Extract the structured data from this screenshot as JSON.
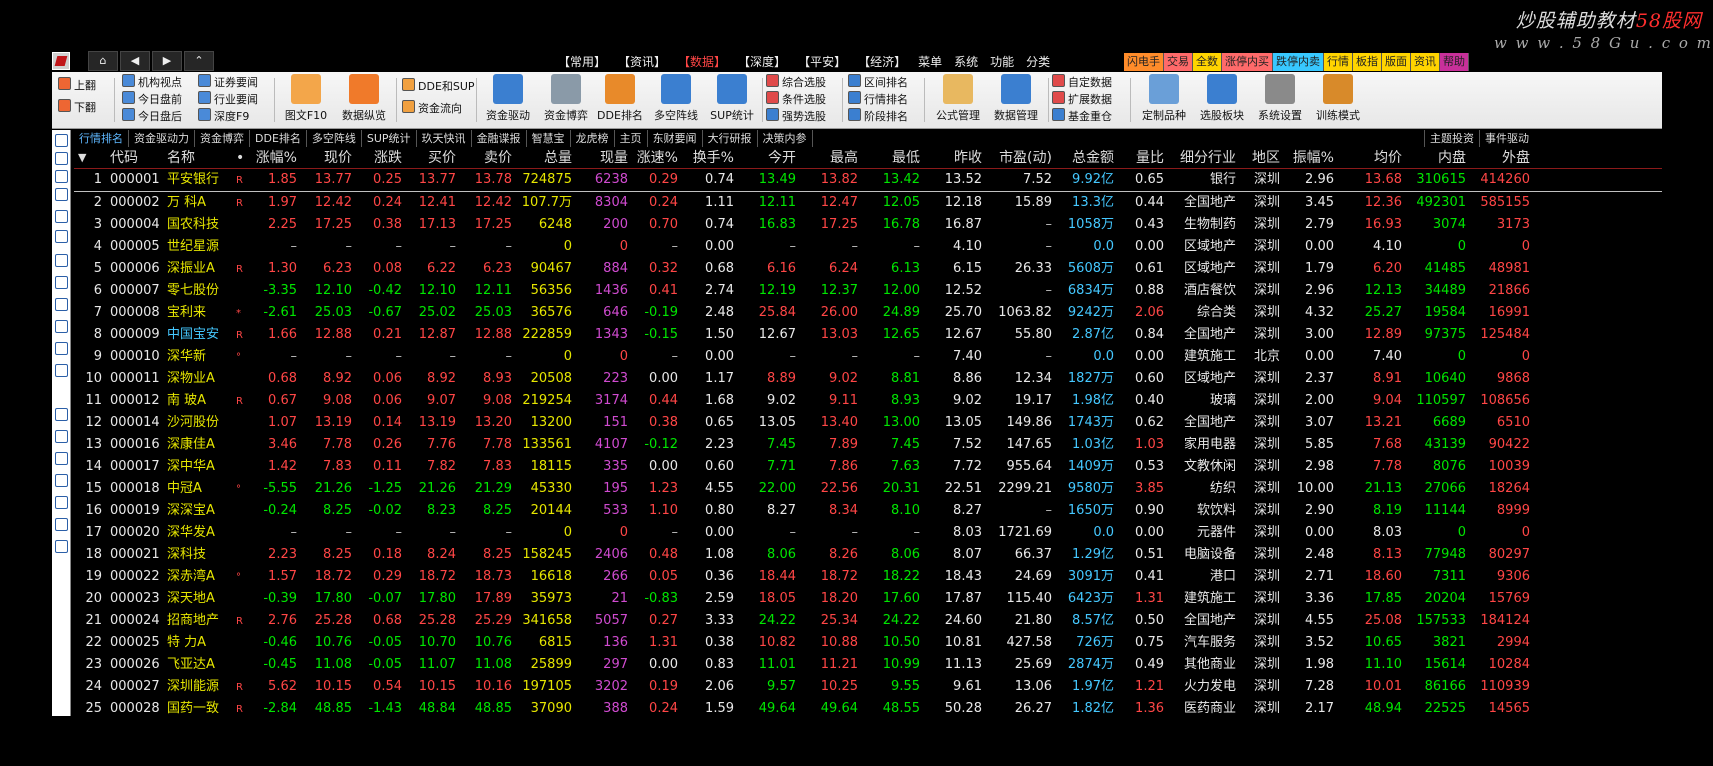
{
  "watermark": {
    "line1_a": "炒股辅助教材",
    "line1_b": "58股网",
    "line2": "w w w . 5 8 G u . c o m"
  },
  "nav": {
    "home": "⌂",
    "back": "◀",
    "forward": "▶",
    "up": "⌃"
  },
  "menu": {
    "items": [
      "【常用】",
      "【资讯】",
      "【数据】",
      "【深度】",
      "【平安】",
      "【经济】",
      "菜单",
      "系统",
      "功能",
      "分类"
    ],
    "active_index": 2,
    "right_tabs": [
      {
        "label": "闪电手",
        "bg": "#ff8c2a"
      },
      {
        "label": "交易",
        "bg": "#ff6a6a"
      },
      {
        "label": "全数",
        "bg": "#ffd400"
      },
      {
        "label": "涨停内买",
        "bg": "#ff6a6a"
      },
      {
        "label": "跌停内卖",
        "bg": "#38c8ff"
      },
      {
        "label": "行情",
        "bg": "#ffd400"
      },
      {
        "label": "板指",
        "bg": "#ffd400"
      },
      {
        "label": "版面",
        "bg": "#ffd400"
      },
      {
        "label": "资讯",
        "bg": "#ffd400"
      },
      {
        "label": "帮助",
        "bg": "#c8309a"
      }
    ]
  },
  "toolbar": {
    "flip_up": "上翻",
    "flip_down": "下翻",
    "inst_view": "机构视点",
    "today_before": "今日盘前",
    "today_after": "今日盘后",
    "broker_report": "证券要闻",
    "industry_news": "行业要闻",
    "depth_f9": "深度F9",
    "f10": "图文F10",
    "data_view": "数据纵览",
    "dde_sup": "DDE和SUP",
    "fund_flow": "资金流向",
    "fund_drive": "资金驱动",
    "fund_game": "资金博弈",
    "dde_rank": "DDE排名",
    "multi_line": "多空阵线",
    "sup_stat": "SUP统计",
    "combo_pick": "综合选股",
    "cond_pick": "条件选股",
    "strong_pick": "强势选股",
    "range_rank": "区间排名",
    "quote_rank": "行情排名",
    "stage_rank": "阶段排名",
    "formula_mgr": "公式管理",
    "data_mgr": "数据管理",
    "custom_data": "自定数据",
    "ext_data": "扩展数据",
    "fund_pos": "基金重仓",
    "custom_kind": "定制品种",
    "pick_board": "选股板块",
    "sys_set": "系统设置",
    "train_mode": "训练模式"
  },
  "func_tabs": [
    "行情排名",
    "资金驱动力",
    "资金博弈",
    "DDE排名",
    "多空阵线",
    "SUP统计",
    "玖天快讯",
    "金融谍报",
    "智慧宝",
    "龙虎榜",
    "主页",
    "东财要闻",
    "大行研报",
    "决策内参"
  ],
  "func_tabs_active": 0,
  "func_tabs_right": [
    "主题投资",
    "事件驱动"
  ],
  "table": {
    "sort_icon": "▼",
    "columns": [
      "代码",
      "名称",
      "•",
      "涨幅%",
      "现价",
      "涨跌",
      "买价",
      "卖价",
      "总量",
      "现量",
      "涨速%",
      "换手%",
      "今开",
      "最高",
      "最低",
      "昨收",
      "市盈(动)",
      "总金额",
      "量比",
      "细分行业",
      "地区",
      "振幅%",
      "均价",
      "内盘",
      "外盘"
    ],
    "rows": [
      {
        "n": "1",
        "code": "000001",
        "name": "平安银行",
        "mk": "R",
        "pct": "1.85",
        "price": "13.77",
        "chg": "0.25",
        "bid": "13.77",
        "ask": "13.78",
        "vol": "724875",
        "cur": "6238",
        "spd": "0.29",
        "turn": "0.74",
        "open": "13.49",
        "high": "13.82",
        "low": "13.42",
        "prev": "13.52",
        "pe": "7.52",
        "amt": "9.92亿",
        "lb": "0.65",
        "ind": "银行",
        "reg": "深圳",
        "amp": "2.96",
        "avg": "13.68",
        "inn": "310615",
        "out": "414260",
        "t": "u"
      },
      {
        "n": "2",
        "code": "000002",
        "name": "万  科A",
        "mk": "R",
        "pct": "1.97",
        "price": "12.42",
        "chg": "0.24",
        "bid": "12.41",
        "ask": "12.42",
        "vol": "107.7万",
        "cur": "8304",
        "spd": "0.24",
        "turn": "1.11",
        "open": "12.11",
        "high": "12.47",
        "low": "12.05",
        "prev": "12.18",
        "pe": "15.89",
        "amt": "13.3亿",
        "lb": "0.44",
        "ind": "全国地产",
        "reg": "深圳",
        "amp": "3.45",
        "avg": "12.36",
        "inn": "492301",
        "out": "585155",
        "t": "u"
      },
      {
        "n": "3",
        "code": "000004",
        "name": "国农科技",
        "mk": "",
        "pct": "2.25",
        "price": "17.25",
        "chg": "0.38",
        "bid": "17.13",
        "ask": "17.25",
        "vol": "6248",
        "cur": "200",
        "spd": "0.70",
        "turn": "0.74",
        "open": "16.83",
        "high": "17.25",
        "low": "16.78",
        "prev": "16.87",
        "pe": "–",
        "amt": "1058万",
        "lb": "0.43",
        "ind": "生物制药",
        "reg": "深圳",
        "amp": "2.79",
        "avg": "16.93",
        "inn": "3074",
        "out": "3173",
        "t": "u"
      },
      {
        "n": "4",
        "code": "000005",
        "name": "世纪星源",
        "mk": "",
        "pct": "–",
        "price": "–",
        "chg": "–",
        "bid": "–",
        "ask": "–",
        "vol": "0",
        "cur": "0",
        "spd": "–",
        "turn": "0.00",
        "open": "–",
        "high": "–",
        "low": "–",
        "prev": "4.10",
        "pe": "–",
        "amt": "0.0",
        "lb": "0.00",
        "ind": "区域地产",
        "reg": "深圳",
        "amp": "0.00",
        "avg": "4.10",
        "inn": "0",
        "out": "0",
        "t": "n"
      },
      {
        "n": "5",
        "code": "000006",
        "name": "深振业A",
        "mk": "R",
        "pct": "1.30",
        "price": "6.23",
        "chg": "0.08",
        "bid": "6.22",
        "ask": "6.23",
        "vol": "90467",
        "cur": "884",
        "spd": "0.32",
        "turn": "0.68",
        "open": "6.16",
        "high": "6.24",
        "low": "6.13",
        "prev": "6.15",
        "pe": "26.33",
        "amt": "5608万",
        "lb": "0.61",
        "ind": "区域地产",
        "reg": "深圳",
        "amp": "1.79",
        "avg": "6.20",
        "inn": "41485",
        "out": "48981",
        "t": "u"
      },
      {
        "n": "6",
        "code": "000007",
        "name": "零七股份",
        "mk": "",
        "pct": "-3.35",
        "price": "12.10",
        "chg": "-0.42",
        "bid": "12.10",
        "ask": "12.11",
        "vol": "56356",
        "cur": "1436",
        "spd": "0.41",
        "turn": "2.74",
        "open": "12.19",
        "high": "12.37",
        "low": "12.00",
        "prev": "12.52",
        "pe": "–",
        "amt": "6834万",
        "lb": "0.88",
        "ind": "酒店餐饮",
        "reg": "深圳",
        "amp": "2.96",
        "avg": "12.13",
        "inn": "34489",
        "out": "21866",
        "t": "d"
      },
      {
        "n": "7",
        "code": "000008",
        "name": "宝利来",
        "mk": "*",
        "pct": "-2.61",
        "price": "25.03",
        "chg": "-0.67",
        "bid": "25.02",
        "ask": "25.03",
        "vol": "36576",
        "cur": "646",
        "spd": "-0.19",
        "turn": "2.48",
        "open": "25.84",
        "high": "26.00",
        "low": "24.89",
        "prev": "25.70",
        "pe": "1063.82",
        "amt": "9242万",
        "lb": "2.06",
        "ind": "综合类",
        "reg": "深圳",
        "amp": "4.32",
        "avg": "25.27",
        "inn": "19584",
        "out": "16991",
        "t": "d"
      },
      {
        "n": "8",
        "code": "000009",
        "name": "中国宝安",
        "mk": "R",
        "pct": "1.66",
        "price": "12.88",
        "chg": "0.21",
        "bid": "12.87",
        "ask": "12.88",
        "vol": "222859",
        "cur": "1343",
        "spd": "-0.15",
        "turn": "1.50",
        "open": "12.67",
        "high": "13.03",
        "low": "12.65",
        "prev": "12.67",
        "pe": "55.80",
        "amt": "2.87亿",
        "lb": "0.84",
        "ind": "全国地产",
        "reg": "深圳",
        "amp": "3.00",
        "avg": "12.89",
        "inn": "97375",
        "out": "125484",
        "t": "u"
      },
      {
        "n": "9",
        "code": "000010",
        "name": "深华新",
        "mk": "°",
        "pct": "–",
        "price": "–",
        "chg": "–",
        "bid": "–",
        "ask": "–",
        "vol": "0",
        "cur": "0",
        "spd": "–",
        "turn": "0.00",
        "open": "–",
        "high": "–",
        "low": "–",
        "prev": "7.40",
        "pe": "–",
        "amt": "0.0",
        "lb": "0.00",
        "ind": "建筑施工",
        "reg": "北京",
        "amp": "0.00",
        "avg": "7.40",
        "inn": "0",
        "out": "0",
        "t": "n"
      },
      {
        "n": "10",
        "code": "000011",
        "name": "深物业A",
        "mk": "",
        "pct": "0.68",
        "price": "8.92",
        "chg": "0.06",
        "bid": "8.92",
        "ask": "8.93",
        "vol": "20508",
        "cur": "223",
        "spd": "0.00",
        "turn": "1.17",
        "open": "8.89",
        "high": "9.02",
        "low": "8.81",
        "prev": "8.86",
        "pe": "12.34",
        "amt": "1827万",
        "lb": "0.60",
        "ind": "区域地产",
        "reg": "深圳",
        "amp": "2.37",
        "avg": "8.91",
        "inn": "10640",
        "out": "9868",
        "t": "u"
      },
      {
        "n": "11",
        "code": "000012",
        "name": "南  玻A",
        "mk": "R",
        "pct": "0.67",
        "price": "9.08",
        "chg": "0.06",
        "bid": "9.07",
        "ask": "9.08",
        "vol": "219254",
        "cur": "3174",
        "spd": "0.44",
        "turn": "1.68",
        "open": "9.02",
        "high": "9.11",
        "low": "8.93",
        "prev": "9.02",
        "pe": "19.17",
        "amt": "1.98亿",
        "lb": "0.40",
        "ind": "玻璃",
        "reg": "深圳",
        "amp": "2.00",
        "avg": "9.04",
        "inn": "110597",
        "out": "108656",
        "t": "u"
      },
      {
        "n": "12",
        "code": "000014",
        "name": "沙河股份",
        "mk": "",
        "pct": "1.07",
        "price": "13.19",
        "chg": "0.14",
        "bid": "13.19",
        "ask": "13.20",
        "vol": "13200",
        "cur": "151",
        "spd": "0.38",
        "turn": "0.65",
        "open": "13.05",
        "high": "13.40",
        "low": "13.00",
        "prev": "13.05",
        "pe": "149.86",
        "amt": "1743万",
        "lb": "0.62",
        "ind": "全国地产",
        "reg": "深圳",
        "amp": "3.07",
        "avg": "13.21",
        "inn": "6689",
        "out": "6510",
        "t": "u"
      },
      {
        "n": "13",
        "code": "000016",
        "name": "深康佳A",
        "mk": "",
        "pct": "3.46",
        "price": "7.78",
        "chg": "0.26",
        "bid": "7.76",
        "ask": "7.78",
        "vol": "133561",
        "cur": "4107",
        "spd": "-0.12",
        "turn": "2.23",
        "open": "7.45",
        "high": "7.89",
        "low": "7.45",
        "prev": "7.52",
        "pe": "147.65",
        "amt": "1.03亿",
        "lb": "1.03",
        "ind": "家用电器",
        "reg": "深圳",
        "amp": "5.85",
        "avg": "7.68",
        "inn": "43139",
        "out": "90422",
        "t": "u"
      },
      {
        "n": "14",
        "code": "000017",
        "name": "深中华A",
        "mk": "",
        "pct": "1.42",
        "price": "7.83",
        "chg": "0.11",
        "bid": "7.82",
        "ask": "7.83",
        "vol": "18115",
        "cur": "335",
        "spd": "0.00",
        "turn": "0.60",
        "open": "7.71",
        "high": "7.86",
        "low": "7.63",
        "prev": "7.72",
        "pe": "955.64",
        "amt": "1409万",
        "lb": "0.53",
        "ind": "文教休闲",
        "reg": "深圳",
        "amp": "2.98",
        "avg": "7.78",
        "inn": "8076",
        "out": "10039",
        "t": "u"
      },
      {
        "n": "15",
        "code": "000018",
        "name": "中冠A",
        "mk": "°",
        "pct": "-5.55",
        "price": "21.26",
        "chg": "-1.25",
        "bid": "21.26",
        "ask": "21.29",
        "vol": "45330",
        "cur": "195",
        "spd": "1.23",
        "turn": "4.55",
        "open": "22.00",
        "high": "22.56",
        "low": "20.31",
        "prev": "22.51",
        "pe": "2299.21",
        "amt": "9580万",
        "lb": "3.85",
        "ind": "纺织",
        "reg": "深圳",
        "amp": "10.00",
        "avg": "21.13",
        "inn": "27066",
        "out": "18264",
        "t": "d"
      },
      {
        "n": "16",
        "code": "000019",
        "name": "深深宝A",
        "mk": "",
        "pct": "-0.24",
        "price": "8.25",
        "chg": "-0.02",
        "bid": "8.23",
        "ask": "8.25",
        "vol": "20144",
        "cur": "533",
        "spd": "1.10",
        "turn": "0.80",
        "open": "8.27",
        "high": "8.34",
        "low": "8.10",
        "prev": "8.27",
        "pe": "–",
        "amt": "1650万",
        "lb": "0.90",
        "ind": "软饮料",
        "reg": "深圳",
        "amp": "2.90",
        "avg": "8.19",
        "inn": "11144",
        "out": "8999",
        "t": "d"
      },
      {
        "n": "17",
        "code": "000020",
        "name": "深华发A",
        "mk": "",
        "pct": "–",
        "price": "–",
        "chg": "–",
        "bid": "–",
        "ask": "–",
        "vol": "0",
        "cur": "0",
        "spd": "–",
        "turn": "0.00",
        "open": "–",
        "high": "–",
        "low": "–",
        "prev": "8.03",
        "pe": "1721.69",
        "amt": "0.0",
        "lb": "0.00",
        "ind": "元器件",
        "reg": "深圳",
        "amp": "0.00",
        "avg": "8.03",
        "inn": "0",
        "out": "0",
        "t": "n"
      },
      {
        "n": "18",
        "code": "000021",
        "name": "深科技",
        "mk": "",
        "pct": "2.23",
        "price": "8.25",
        "chg": "0.18",
        "bid": "8.24",
        "ask": "8.25",
        "vol": "158245",
        "cur": "2406",
        "spd": "0.48",
        "turn": "1.08",
        "open": "8.06",
        "high": "8.26",
        "low": "8.06",
        "prev": "8.07",
        "pe": "66.37",
        "amt": "1.29亿",
        "lb": "0.51",
        "ind": "电脑设备",
        "reg": "深圳",
        "amp": "2.48",
        "avg": "8.13",
        "inn": "77948",
        "out": "80297",
        "t": "u"
      },
      {
        "n": "19",
        "code": "000022",
        "name": "深赤湾A",
        "mk": "°",
        "pct": "1.57",
        "price": "18.72",
        "chg": "0.29",
        "bid": "18.72",
        "ask": "18.73",
        "vol": "16618",
        "cur": "266",
        "spd": "0.05",
        "turn": "0.36",
        "open": "18.44",
        "high": "18.72",
        "low": "18.22",
        "prev": "18.43",
        "pe": "24.69",
        "amt": "3091万",
        "lb": "0.41",
        "ind": "港口",
        "reg": "深圳",
        "amp": "2.71",
        "avg": "18.60",
        "inn": "7311",
        "out": "9306",
        "t": "u"
      },
      {
        "n": "20",
        "code": "000023",
        "name": "深天地A",
        "mk": "",
        "pct": "-0.39",
        "price": "17.80",
        "chg": "-0.07",
        "bid": "17.80",
        "ask": "17.89",
        "vol": "35973",
        "cur": "21",
        "spd": "-0.83",
        "turn": "2.59",
        "open": "18.05",
        "high": "18.20",
        "low": "17.60",
        "prev": "17.87",
        "pe": "115.40",
        "amt": "6423万",
        "lb": "1.31",
        "ind": "建筑施工",
        "reg": "深圳",
        "amp": "3.36",
        "avg": "17.85",
        "inn": "20204",
        "out": "15769",
        "t": "d"
      },
      {
        "n": "21",
        "code": "000024",
        "name": "招商地产",
        "mk": "R",
        "pct": "2.76",
        "price": "25.28",
        "chg": "0.68",
        "bid": "25.28",
        "ask": "25.29",
        "vol": "341658",
        "cur": "5057",
        "spd": "0.27",
        "turn": "3.33",
        "open": "24.22",
        "high": "25.34",
        "low": "24.22",
        "prev": "24.60",
        "pe": "21.80",
        "amt": "8.57亿",
        "lb": "0.50",
        "ind": "全国地产",
        "reg": "深圳",
        "amp": "4.55",
        "avg": "25.08",
        "inn": "157533",
        "out": "184124",
        "t": "u"
      },
      {
        "n": "22",
        "code": "000025",
        "name": "特  力A",
        "mk": "",
        "pct": "-0.46",
        "price": "10.76",
        "chg": "-0.05",
        "bid": "10.70",
        "ask": "10.76",
        "vol": "6815",
        "cur": "136",
        "spd": "1.31",
        "turn": "0.38",
        "open": "10.82",
        "high": "10.88",
        "low": "10.50",
        "prev": "10.81",
        "pe": "427.58",
        "amt": "726万",
        "lb": "0.75",
        "ind": "汽车服务",
        "reg": "深圳",
        "amp": "3.52",
        "avg": "10.65",
        "inn": "3821",
        "out": "2994",
        "t": "d"
      },
      {
        "n": "23",
        "code": "000026",
        "name": "飞亚达A",
        "mk": "",
        "pct": "-0.45",
        "price": "11.08",
        "chg": "-0.05",
        "bid": "11.07",
        "ask": "11.08",
        "vol": "25899",
        "cur": "297",
        "spd": "0.00",
        "turn": "0.83",
        "open": "11.01",
        "high": "11.21",
        "low": "10.99",
        "prev": "11.13",
        "pe": "25.69",
        "amt": "2874万",
        "lb": "0.49",
        "ind": "其他商业",
        "reg": "深圳",
        "amp": "1.98",
        "avg": "11.10",
        "inn": "15614",
        "out": "10284",
        "t": "d"
      },
      {
        "n": "24",
        "code": "000027",
        "name": "深圳能源",
        "mk": "R",
        "pct": "5.62",
        "price": "10.15",
        "chg": "0.54",
        "bid": "10.15",
        "ask": "10.16",
        "vol": "197105",
        "cur": "3202",
        "spd": "0.19",
        "turn": "2.06",
        "open": "9.57",
        "high": "10.25",
        "low": "9.55",
        "prev": "9.61",
        "pe": "13.06",
        "amt": "1.97亿",
        "lb": "1.21",
        "ind": "火力发电",
        "reg": "深圳",
        "amp": "7.28",
        "avg": "10.01",
        "inn": "86166",
        "out": "110939",
        "t": "u"
      },
      {
        "n": "25",
        "code": "000028",
        "name": "国药一致",
        "mk": "R",
        "pct": "-2.84",
        "price": "48.85",
        "chg": "-1.43",
        "bid": "48.84",
        "ask": "48.85",
        "vol": "37090",
        "cur": "388",
        "spd": "0.24",
        "turn": "1.59",
        "open": "49.64",
        "high": "49.64",
        "low": "48.55",
        "prev": "50.28",
        "pe": "26.27",
        "amt": "1.82亿",
        "lb": "1.36",
        "ind": "医药商业",
        "reg": "深圳",
        "amp": "2.17",
        "avg": "48.94",
        "inn": "22525",
        "out": "14565",
        "t": "d"
      }
    ]
  }
}
